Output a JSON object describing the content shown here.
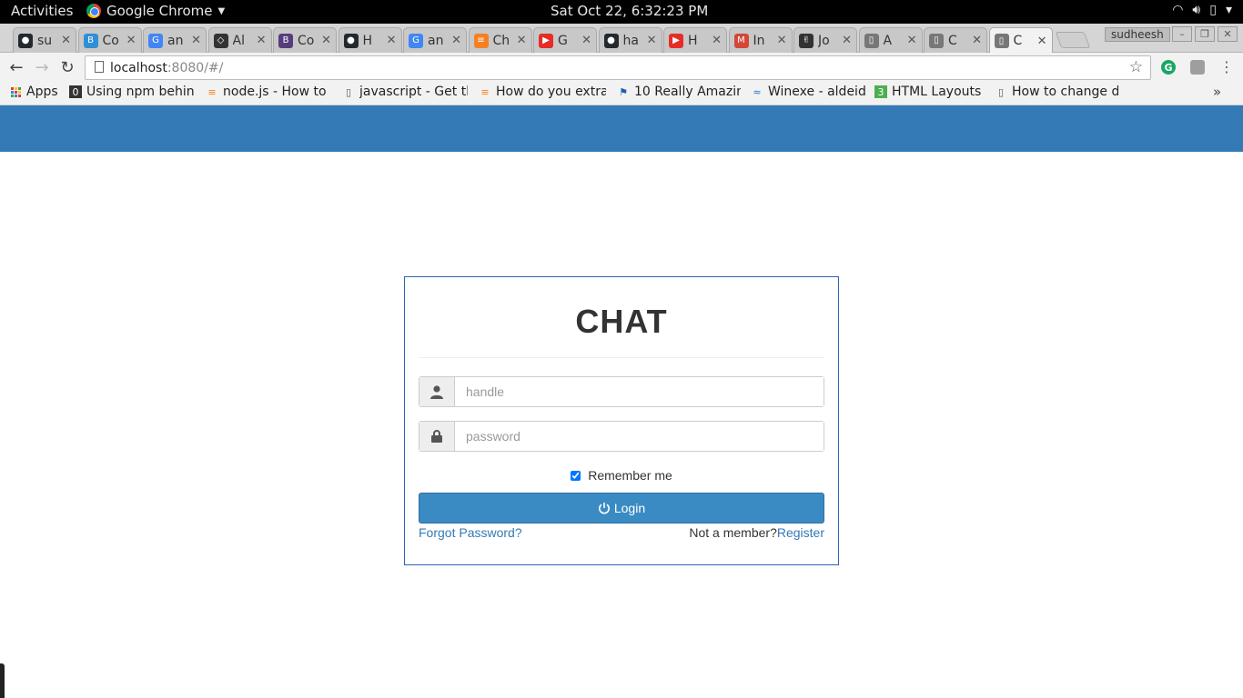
{
  "system_bar": {
    "activities": "Activities",
    "app_name": "Google Chrome",
    "clock": "Sat Oct 22,  6:32:23 PM"
  },
  "tabs": [
    {
      "label": "su",
      "icon": "github-icon",
      "color": "#24292e"
    },
    {
      "label": "Co",
      "icon": "bootstrap-cdn-icon",
      "color": "#2f8fd5"
    },
    {
      "label": "an",
      "icon": "google-icon",
      "color": "#4285f4"
    },
    {
      "label": "Al",
      "icon": "codepen-icon",
      "color": "#333333"
    },
    {
      "label": "Co",
      "icon": "bootstrap-icon",
      "color": "#563d7c"
    },
    {
      "label": "H",
      "icon": "github-icon",
      "color": "#24292e"
    },
    {
      "label": "an",
      "icon": "google-icon",
      "color": "#4285f4"
    },
    {
      "label": "Ch",
      "icon": "stackoverflow-icon",
      "color": "#f48024"
    },
    {
      "label": "G",
      "icon": "youtube-icon",
      "color": "#e52d27"
    },
    {
      "label": "ha",
      "icon": "github-icon",
      "color": "#24292e"
    },
    {
      "label": "H",
      "icon": "youtube-icon",
      "color": "#e52d27"
    },
    {
      "label": "In",
      "icon": "gmail-icon",
      "color": "#d44638"
    },
    {
      "label": "Jo",
      "icon": "angellist-icon",
      "color": "#333333"
    },
    {
      "label": "A",
      "icon": "page-icon",
      "color": "#777777"
    },
    {
      "label": "C",
      "icon": "page-icon",
      "color": "#777777"
    },
    {
      "label": "C",
      "icon": "page-icon",
      "color": "#777777",
      "active": true
    }
  ],
  "profile_name": "sudheesh",
  "address_bar": {
    "host": "localhost",
    "path": ":8080/#/"
  },
  "bookmarks": [
    {
      "label": "Apps",
      "icon": "apps-grid-icon"
    },
    {
      "label": "Using npm behind",
      "icon": "npm-icon"
    },
    {
      "label": "node.js - How to",
      "icon": "stackoverflow-icon"
    },
    {
      "label": "javascript - Get th",
      "icon": "page-icon"
    },
    {
      "label": "How do you extra",
      "icon": "stackoverflow-icon"
    },
    {
      "label": "10 Really Amazin",
      "icon": "flag-icon"
    },
    {
      "label": "Winexe - aldeid",
      "icon": "aldeid-icon"
    },
    {
      "label": "HTML Layouts",
      "icon": "w3schools-icon"
    },
    {
      "label": "How to change d",
      "icon": "page-icon"
    }
  ],
  "login": {
    "title": "CHAT",
    "handle_placeholder": "handle",
    "handle_value": "",
    "password_placeholder": "password",
    "password_value": "",
    "remember_label": "Remember me",
    "remember_checked": true,
    "login_label": "Login",
    "forgot_label": "Forgot Password?",
    "not_member_label": "Not a member?",
    "register_label": "Register"
  },
  "colors": {
    "header_blue": "#337ab7",
    "button_blue": "#3a8bc3",
    "link_blue": "#337ab7",
    "card_border": "#2e62b5"
  }
}
